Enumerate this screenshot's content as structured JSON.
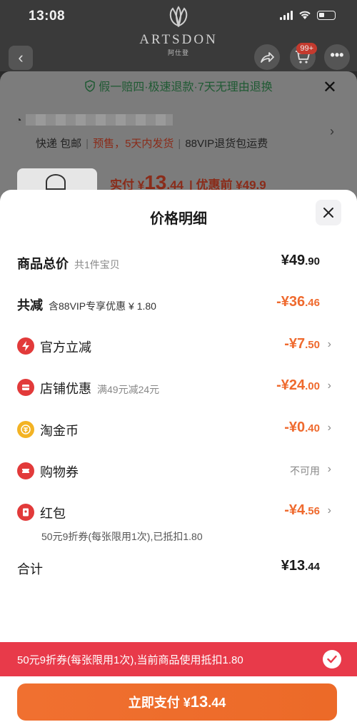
{
  "status": {
    "time": "13:08"
  },
  "brand": {
    "name": "ARTSDON",
    "sub": "阿仕登"
  },
  "nav": {
    "back": "‹",
    "cart_badge": "99+",
    "more": "•••"
  },
  "background": {
    "guarantee": "假一赔四·极速退款·7天无理由退换",
    "close": "✕",
    "ship_express": "快递 包邮",
    "ship_presale": "预售，5天内发货",
    "ship_vip": "88VIP退货包运费",
    "paid_label": "实付 ¥",
    "paid_int": "13",
    "paid_dec": ".44",
    "before": "| 优惠前 ¥49.9"
  },
  "sheet": {
    "title": "价格明细",
    "rows": [
      {
        "label": "商品总价",
        "sub": "共1件宝贝",
        "amount_int": "¥49",
        "amount_dec": ".90"
      },
      {
        "label": "共减",
        "sub": "含88VIP专享优惠 ¥ 1.80",
        "amount_int": "-¥36",
        "amount_dec": ".46"
      },
      {
        "label": "官方立减",
        "amount_int": "-¥7",
        "amount_dec": ".50",
        "icon": "lightning-icon"
      },
      {
        "label": "店铺优惠",
        "sub": "满49元减24元",
        "amount_int": "-¥24",
        "amount_dec": ".00",
        "icon": "store-icon"
      },
      {
        "label": "淘金币",
        "amount_int": "-¥0",
        "amount_dec": ".40",
        "icon": "coin-icon"
      },
      {
        "label": "购物券",
        "amount_text": "不可用",
        "icon": "ticket-icon"
      },
      {
        "label": "红包",
        "amount_int": "-¥4",
        "amount_dec": ".56",
        "icon": "red-packet-icon"
      },
      {
        "label": "合计",
        "amount_int": "¥13",
        "amount_dec": ".44"
      }
    ],
    "coupon_note": "50元9折券(每张限用1次),已抵扣1.80",
    "promo_text": "50元9折券(每张限用1次),当前商品使用抵扣1.80",
    "pay_label": "立即支付 ¥",
    "pay_int": "13",
    "pay_dec": ".44"
  },
  "colors": {
    "accent_orange": "#ef6a2e",
    "promo_red": "#e83a4a",
    "icon_red": "#e23a3a",
    "coin_gold": "#f3b324"
  }
}
